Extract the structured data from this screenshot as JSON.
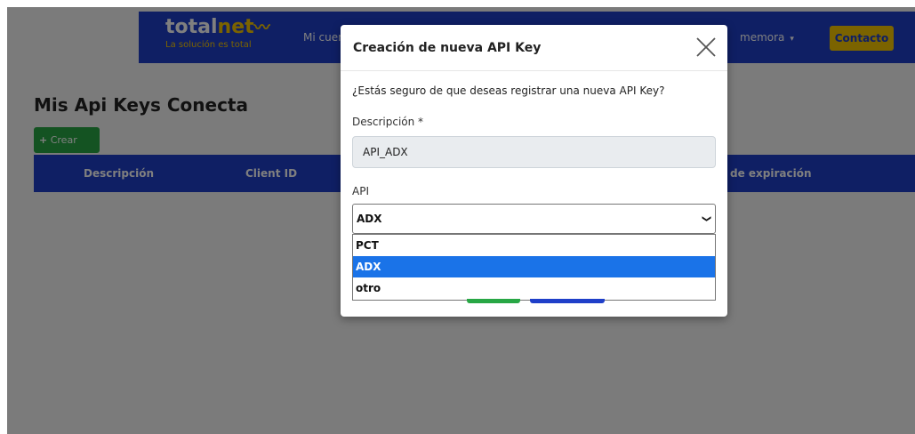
{
  "navbar": {
    "logo_main": "totalnet",
    "logo_main_a": "total",
    "logo_main_b": "net",
    "logo_sub": "La solución es total",
    "menu_item_truncated": "Mi cuen",
    "user_menu": "memora",
    "contact_button": "Contacto"
  },
  "page": {
    "title": "Mis Api Keys Conecta",
    "create_button": "Crear",
    "table_headers": [
      "Descripción",
      "Client ID",
      "de expiración"
    ]
  },
  "modal": {
    "title": "Creación de nueva API Key",
    "question": "¿Estás seguro de que deseas registrar una nueva API Key?",
    "description_label": "Descripción *",
    "description_value": "API_ADX",
    "api_label": "API",
    "api_selected": "ADX",
    "api_options": [
      "PCT",
      "ADX",
      "otro"
    ]
  },
  "colors": {
    "brand_blue": "#1f3fc9",
    "brand_yellow": "#f7c600",
    "success_green": "#28a745",
    "option_highlight": "#1a73e8"
  }
}
